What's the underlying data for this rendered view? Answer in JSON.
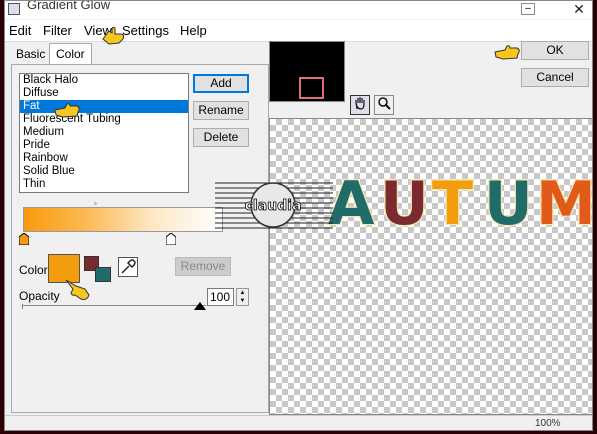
{
  "window": {
    "title": "Gradient Glow",
    "minimize": "–",
    "close": "✕"
  },
  "menu": [
    "Edit",
    "Filter",
    "View",
    "Settings",
    "Help"
  ],
  "tabs": {
    "basic": "Basic",
    "color": "Color"
  },
  "effects": {
    "items": [
      "Black Halo",
      "Diffuse",
      "Fat",
      "Fluorescent Tubing",
      "Medium",
      "Pride",
      "Rainbow",
      "Solid Blue",
      "Thin"
    ],
    "selected": "Fat"
  },
  "buttons": {
    "add": "Add",
    "rename": "Rename",
    "delete": "Delete",
    "remove": "Remove",
    "ok": "OK",
    "cancel": "Cancel"
  },
  "color": {
    "label": "Color",
    "current": "#f39c0e",
    "swatch_a": "#7b2b30",
    "swatch_b": "#1f6c6a",
    "gradient_start": "#f99a0e",
    "gradient_end": "#ffffff"
  },
  "opacity": {
    "label": "Opacity",
    "value": "100"
  },
  "preview": {
    "text": "AUTUMN",
    "letter_colors": [
      "#1f6c6a",
      "#7b2b30",
      "#f39c0e",
      "#1f6c6a",
      "#e05a1a",
      "#1f6c6a"
    ],
    "watermark": "claudia"
  },
  "status": {
    "zoom": "100%"
  },
  "icons": {
    "hand": "hand-icon",
    "zoom": "magnifier-icon",
    "eyedropper": "eyedropper-icon",
    "pointer": "pointing-hand-icon"
  }
}
